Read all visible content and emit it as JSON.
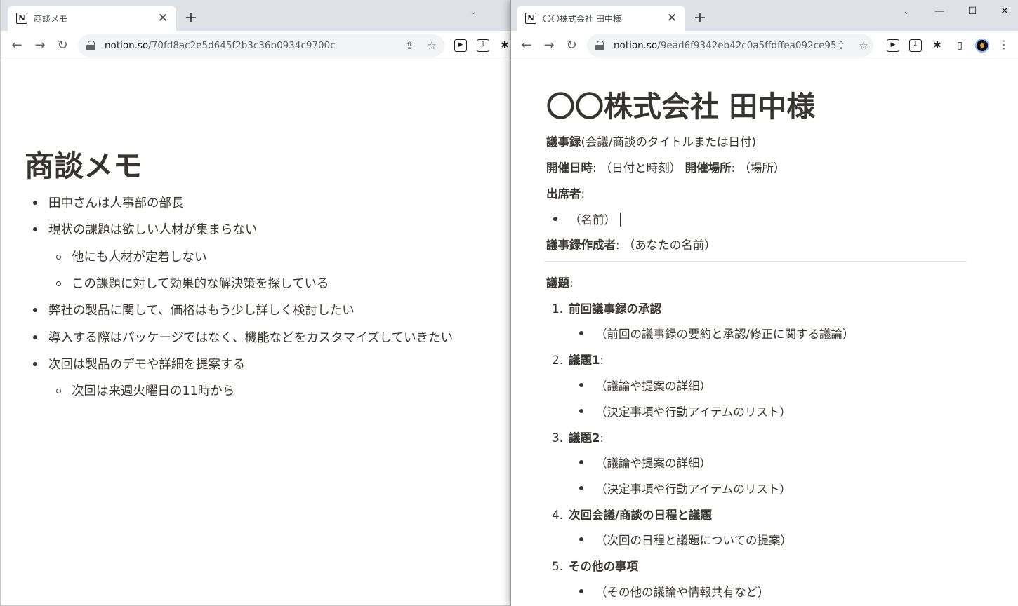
{
  "left_window": {
    "tab_title": "商談メモ",
    "url_host": "notion.so",
    "url_path": "/70fd8ac2e5d645f2b3c36b0934c9700c",
    "page_title": "商談メモ",
    "bullets": [
      "田中さんは人事部の部長",
      "現状の課題は欲しい人材が集まらない",
      "他にも人材が定着しない",
      "この課題に対して効果的な解決策を探している",
      "弊社の製品に関して、価格はもう少し詳しく検討したい",
      "導入する際はパッケージではなく、機能などをカスタマイズしていきたい",
      "次回は製品のデモや詳細を提案する",
      "次回は来週火曜日の11時から"
    ]
  },
  "right_window": {
    "tab_title": "〇〇株式会社 田中様",
    "url_host": "notion.so",
    "url_path": "/9ead6f9342eb42c0a5ffdffea092ce95",
    "page_title": "〇〇株式会社 田中様",
    "minutes_label": "議事録",
    "minutes_value": "(会議/商談のタイトルまたは日付)",
    "datetime_label": "開催日時",
    "datetime_value": ": （日付と時刻）",
    "place_label": "開催場所",
    "place_value": ": （場所）",
    "attendees_label": "出席者",
    "attendees_colon": ":",
    "attendee_item": "（名前）",
    "author_label": "議事録作成者",
    "author_value": ": （あなたの名前）",
    "agenda_label": "議題",
    "agenda_colon": ":",
    "agenda": [
      {
        "num": "1.",
        "title": "前回議事録の承認",
        "suffix": "",
        "items": [
          "（前回の議事録の要約と承認/修正に関する議論）"
        ]
      },
      {
        "num": "2.",
        "title": "議題1",
        "suffix": ":",
        "items": [
          "（議論や提案の詳細）",
          "（決定事項や行動アイテムのリスト）"
        ]
      },
      {
        "num": "3.",
        "title": "議題2",
        "suffix": ":",
        "items": [
          "（議論や提案の詳細）",
          "（決定事項や行動アイテムのリスト）"
        ]
      },
      {
        "num": "4.",
        "title": "次回会議/商談の日程と議題",
        "suffix": "",
        "items": [
          "（次回の日程と議題についての提案）"
        ]
      },
      {
        "num": "5.",
        "title": "その他の事項",
        "suffix": "",
        "items": [
          "（その他の議論や情報共有など）"
        ]
      }
    ]
  },
  "icons": {
    "favicon": "N",
    "close": "✕",
    "new_tab": "+",
    "back": "←",
    "forward": "→",
    "reload": "↻",
    "share": "⇪",
    "star": "☆",
    "extension_a": "▶",
    "extension_b": "⇩",
    "puzzle": "✱",
    "sidepanel": "▯",
    "menu": "⋮",
    "chevron_down": "⌄",
    "minimize": "—",
    "maximize": "☐",
    "window_close": "✕"
  }
}
